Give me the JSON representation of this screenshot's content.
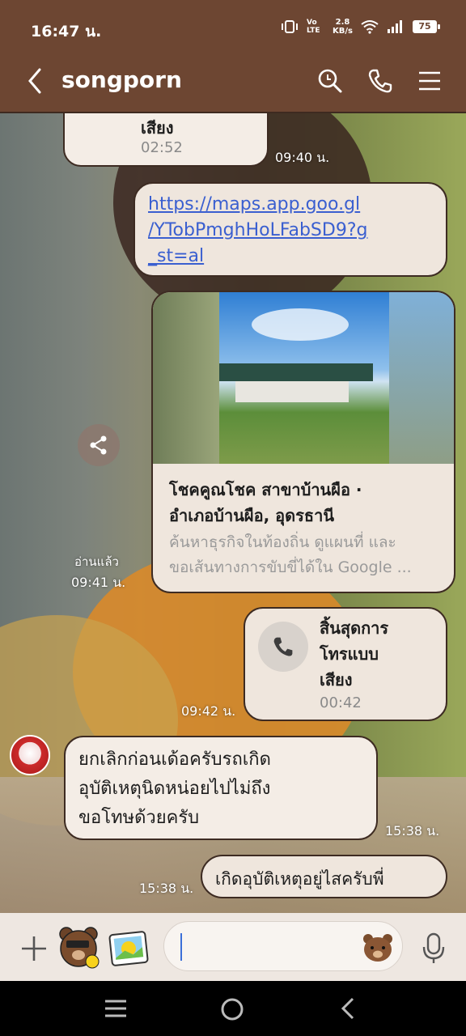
{
  "status": {
    "time": "16:47 น.",
    "network": "Vo LTE",
    "speed_top": "2.8",
    "speed_bottom": "KB/s",
    "battery": "75"
  },
  "header": {
    "title": "songporn"
  },
  "messages": {
    "call1": {
      "label": "เสียง",
      "duration": "02:52",
      "time": "09:40 น."
    },
    "link": {
      "line1": "https://maps.app.goo.gl",
      "line2": "/YTobPmghHoLFabSD9?g",
      "line3": "_st=al"
    },
    "card": {
      "title_line1": "โชคคูณโชค สาขาบ้านผือ ·",
      "title_line2": "อำเภอบ้านผือ, อุดรธานี",
      "desc_line1": "ค้นหาธุรกิจในท้องถิ่น ดูแผนที่ และ",
      "desc_line2": "ขอเส้นทางการขับขี่ได้ใน Google ...",
      "read": "อ่านแล้ว",
      "time": "09:41 น."
    },
    "call2": {
      "line1": "สิ้นสุดการ",
      "line2": "โทรแบบ",
      "line3": "เสียง",
      "duration": "00:42",
      "time": "09:42 น."
    },
    "incoming": {
      "line1": "ยกเลิกก่อนเด้อครับรถเกิด",
      "line2": "อุบัติเหตุนิดหน่อยไปไม่ถึง",
      "line3": "ขอโทษด้วยครับ",
      "time": "15:38 น."
    },
    "last": {
      "text": "เกิดอุบัติเหตุอยู่ไสครับพี่",
      "time": "15:38 น."
    }
  },
  "input": {
    "placeholder": ""
  },
  "colors": {
    "header_bg": "#6d4632",
    "link": "#3a5fd0",
    "bubble": "#f4ede6",
    "border": "#3d2b22"
  }
}
